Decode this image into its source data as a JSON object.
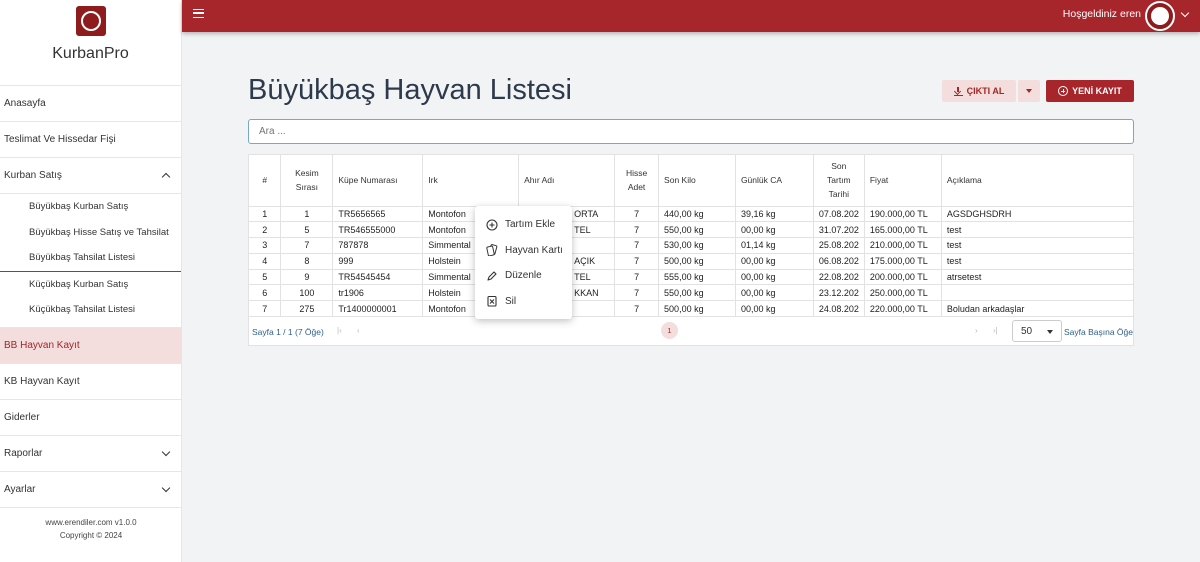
{
  "sidebar": {
    "brand": "KurbanPro",
    "items": [
      {
        "label": "Anasayfa"
      },
      {
        "label": "Teslimat Ve Hissedar Fişi"
      },
      {
        "label": "Kurban Satış"
      },
      {
        "label": "BB Hayvan Kayıt"
      },
      {
        "label": "KB Hayvan Kayıt"
      },
      {
        "label": "Giderler"
      },
      {
        "label": "Raporlar"
      },
      {
        "label": "Ayarlar"
      }
    ],
    "sub_items": [
      {
        "label": "Büyükbaş Kurban Satış"
      },
      {
        "label": "Büyükbaş Hisse Satış ve Tahsilat"
      },
      {
        "label": "Büyükbaş Tahsilat Listesi"
      },
      {
        "label": "Küçükbaş Kurban Satış"
      },
      {
        "label": "Küçükbaş Tahsilat Listesi"
      }
    ],
    "footer_line1": "www.erendiler.com v1.0.0",
    "footer_line2": "Copyright © 2024"
  },
  "topbar": {
    "welcome": "Hoşgeldiniz eren"
  },
  "main": {
    "title": "Büyükbaş Hayvan Listesi",
    "export_label": "ÇIKTI AL",
    "new_label": "YENİ KAYIT",
    "search_placeholder": "Ara ..."
  },
  "table": {
    "headers": [
      "#",
      "Kesim Sırası",
      "Küpe Numarası",
      "Irk",
      "Ahır Adı",
      "Hisse Adet",
      "Son Kilo",
      "Günlük CA",
      "Son Tartım Tarihi",
      "Fiyat",
      "Açıklama"
    ],
    "rows": [
      [
        "1",
        "1",
        "TR5656565",
        "Montofon",
        "ORTA",
        "7",
        "440,00 kg",
        "39,16 kg",
        "07.08.202",
        "190.000,00 TL",
        "AGSDGHSDRH"
      ],
      [
        "2",
        "5",
        "TR546555000",
        "Montofon",
        "TEL",
        "7",
        "550,00 kg",
        "00,00 kg",
        "31.07.202",
        "165.000,00 TL",
        "test"
      ],
      [
        "3",
        "7",
        "787878",
        "Simmental",
        "",
        "7",
        "530,00 kg",
        "01,14 kg",
        "25.08.202",
        "210.000,00 TL",
        "test"
      ],
      [
        "4",
        "8",
        "999",
        "Holstein",
        "AÇIK",
        "7",
        "500,00 kg",
        "00,00 kg",
        "06.08.202",
        "175.000,00 TL",
        "test"
      ],
      [
        "5",
        "9",
        "TR54545454",
        "Simmental",
        "TEL",
        "7",
        "555,00 kg",
        "00,00 kg",
        "22.08.202",
        "200.000,00 TL",
        "atrsetest"
      ],
      [
        "6",
        "100",
        "tr1906",
        "Holstein",
        "KKAN",
        "7",
        "550,00 kg",
        "00,00 kg",
        "23.12.202",
        "250.000,00 TL",
        ""
      ],
      [
        "7",
        "275",
        "Tr1400000001",
        "Montofon",
        "",
        "7",
        "500,00 kg",
        "00,00 kg",
        "24.08.202",
        "220.000,00 TL",
        "Boludan arkadaşlar"
      ]
    ]
  },
  "pager": {
    "info": "Sayfa 1 / 1 (7 Öğe)",
    "current_page": "1",
    "per_page": "50",
    "per_page_label": "Sayfa Başına Öğe"
  },
  "context_menu": {
    "items": [
      {
        "label": "Tartım Ekle",
        "icon": "circle-plus-icon"
      },
      {
        "label": "Hayvan Kartı",
        "icon": "cards-icon"
      },
      {
        "label": "Düzenle",
        "icon": "pencil-icon"
      },
      {
        "label": "Sil",
        "icon": "delete-box-icon"
      }
    ]
  },
  "colors": {
    "brand": "#a6262b",
    "accent_light": "#f3dddd"
  }
}
